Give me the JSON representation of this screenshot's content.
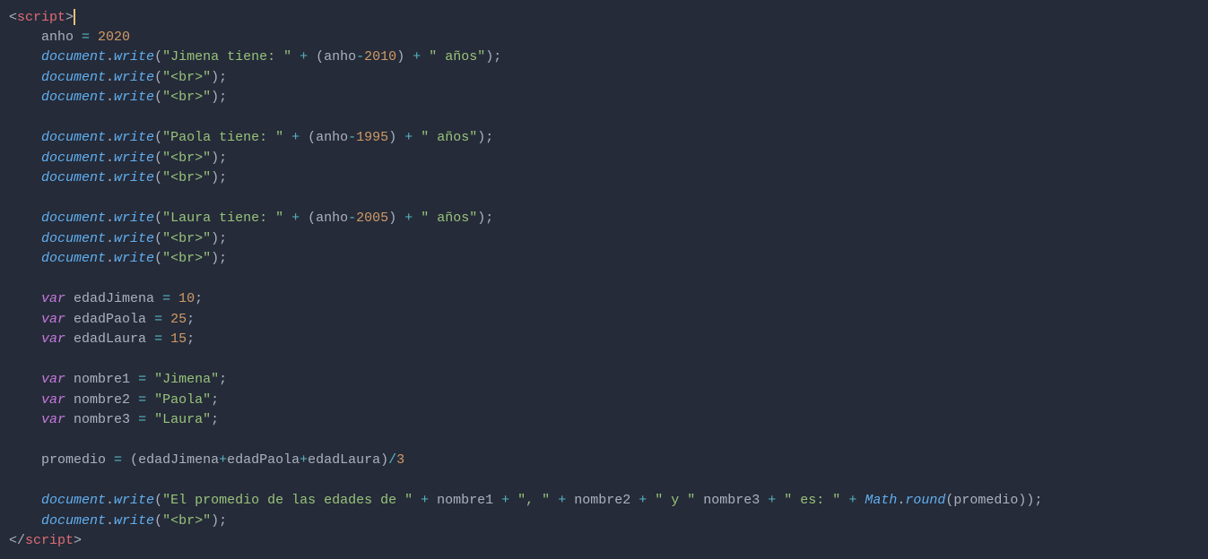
{
  "lines": {
    "l1_tag_open": "<",
    "l1_tag_name": "script",
    "l1_tag_close": ">",
    "indent": "    ",
    "l2_var": "anho",
    "l2_eq": " = ",
    "l2_num": "2020",
    "document": "document",
    "write": "write",
    "dot": ".",
    "l3_str": "\"Jimena tiene: \"",
    "plus": " + ",
    "plus_tight": "+",
    "lp": "(",
    "rp": ")",
    "l3_anho": "anho",
    "l3_minus": "-",
    "l3_year": "2010",
    "l3_str2": "\" años\"",
    "semi": ";",
    "br_str": "\"<br>\"",
    "l6_str": "\"Paola tiene: \"",
    "l6_year": "1995",
    "l9_str": "\"Laura tiene: \"",
    "l9_year": "2005",
    "var_kw": "var",
    "sp": " ",
    "l12_name": "edadJimena",
    "l12_eq": " = ",
    "l12_val": "10",
    "l13_name": "edadPaola",
    "l13_val": "25",
    "l14_name": "edadLaura",
    "l14_val": "15",
    "l15_name": "nombre1",
    "l15_val": "\"Jimena\"",
    "l16_name": "nombre2",
    "l16_val": "\"Paola\"",
    "l17_name": "nombre3",
    "l17_val": "\"Laura\"",
    "l18_prom": "promedio",
    "l18_eq": " = ",
    "l18_e1": "edadJimena",
    "l18_e2": "edadPaola",
    "l18_e3": "edadLaura",
    "l18_div": "/",
    "l18_3": "3",
    "l19_str": "\"El promedio de las edades de \"",
    "l19_n1": "nombre1",
    "l19_c1": "\", \"",
    "l19_n2": "nombre2",
    "l19_y": "\" y \"",
    "l19_n3": "nombre3",
    "l19_es": "\" es: \"",
    "l19_math": "Math",
    "l19_round": "round",
    "l19_prom": "promedio",
    "l21_close_open": "</",
    "l21_close_name": "script",
    "l21_close_end": ">"
  }
}
